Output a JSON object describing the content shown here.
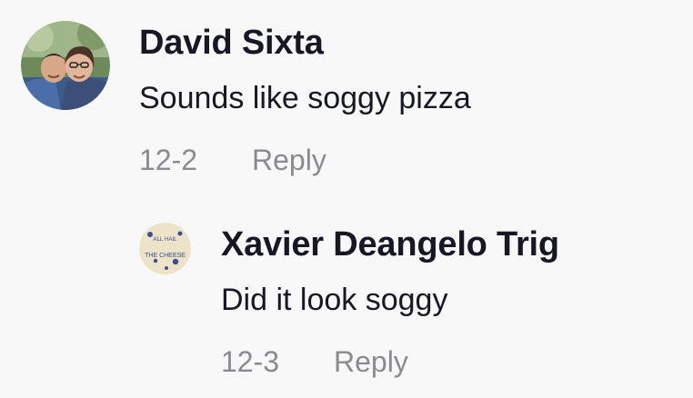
{
  "comments": [
    {
      "author": "David Sixta",
      "text": "Sounds like soggy pizza",
      "date": "12-2",
      "reply_label": "Reply",
      "avatar": "couple-photo-avatar"
    }
  ],
  "replies": [
    {
      "author": "Xavier Deangelo Trig",
      "text": "Did it look soggy",
      "date": "12-3",
      "reply_label": "Reply",
      "avatar": "cheese-logo-avatar",
      "avatar_text": [
        "ALL HAIL",
        "THE CHEESE"
      ]
    }
  ],
  "colors": {
    "background": "#f8f8f8",
    "primary_text": "#161823",
    "secondary_text": "#8a8b91"
  }
}
